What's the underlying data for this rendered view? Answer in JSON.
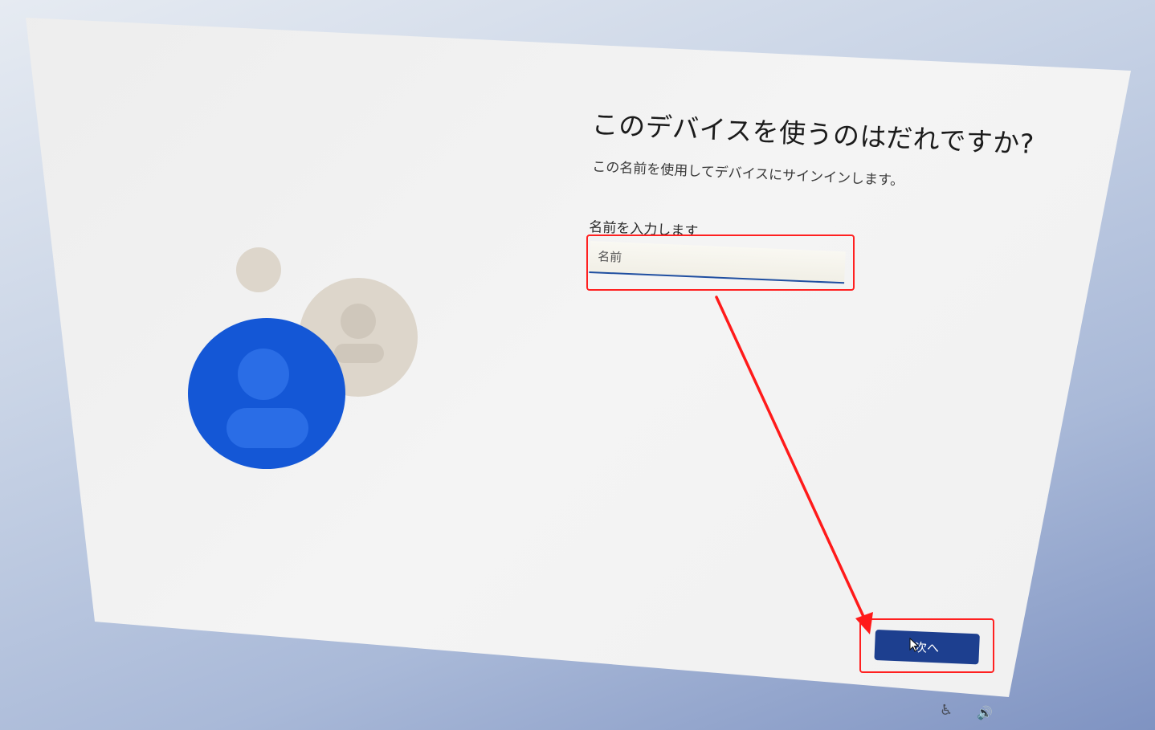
{
  "setup": {
    "title": "このデバイスを使うのはだれですか?",
    "subtitle": "この名前を使用してデバイスにサインインします。",
    "name_field": {
      "label": "名前を入力します",
      "placeholder": "名前",
      "value": ""
    },
    "next_button": {
      "label": "次へ"
    }
  },
  "system_tray": {
    "icons": [
      "accessibility-icon",
      "volume-icon"
    ]
  },
  "colors": {
    "accent": "#1d3f8f",
    "avatar_primary": "#1457d6",
    "avatar_secondary": "#ddd6cb",
    "annotation": "#ff2020"
  }
}
